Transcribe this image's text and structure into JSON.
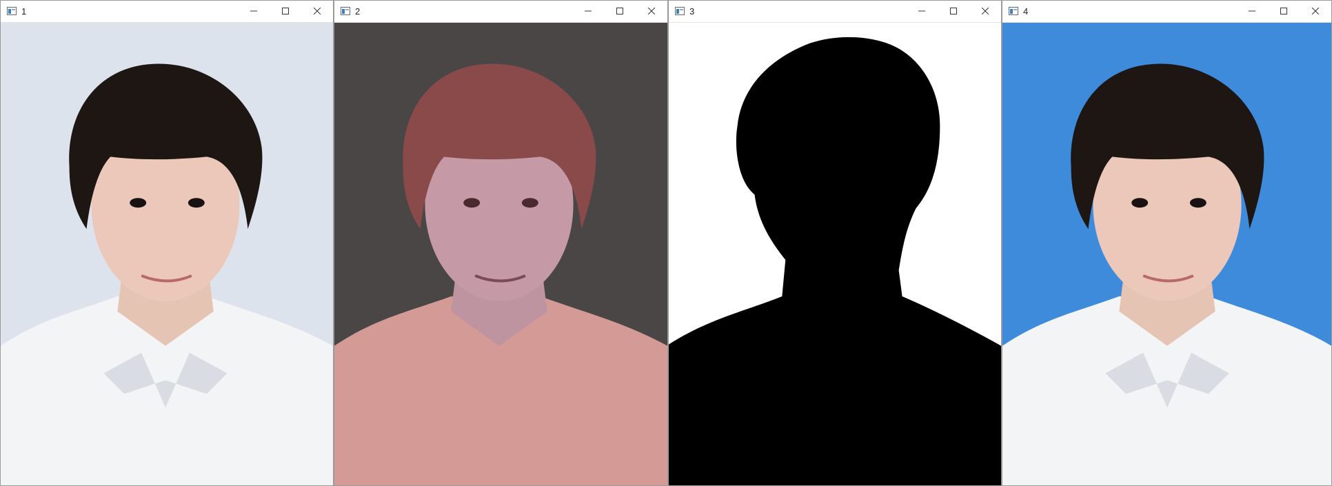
{
  "windows": [
    {
      "title": "1",
      "content": "original-photo",
      "background": "#dde3ec"
    },
    {
      "title": "2",
      "content": "segmentation-overlay",
      "background": "#4a4646"
    },
    {
      "title": "3",
      "content": "binary-mask",
      "background": "#ffffff"
    },
    {
      "title": "4",
      "content": "blue-background-photo",
      "background": "#3f8bdb"
    }
  ],
  "icons": {
    "app": "window-app-icon",
    "minimize": "minimize-icon",
    "maximize": "maximize-icon",
    "close": "close-icon"
  },
  "colors": {
    "hair": "#1d1613",
    "skin": "#e9c6b7",
    "shirt": "#f3f4f6",
    "overlay_fg": "#d39a96",
    "overlay_hair": "#8a4a4a",
    "mask_fg": "#000000",
    "blue_bg": "#3f8bdb"
  }
}
